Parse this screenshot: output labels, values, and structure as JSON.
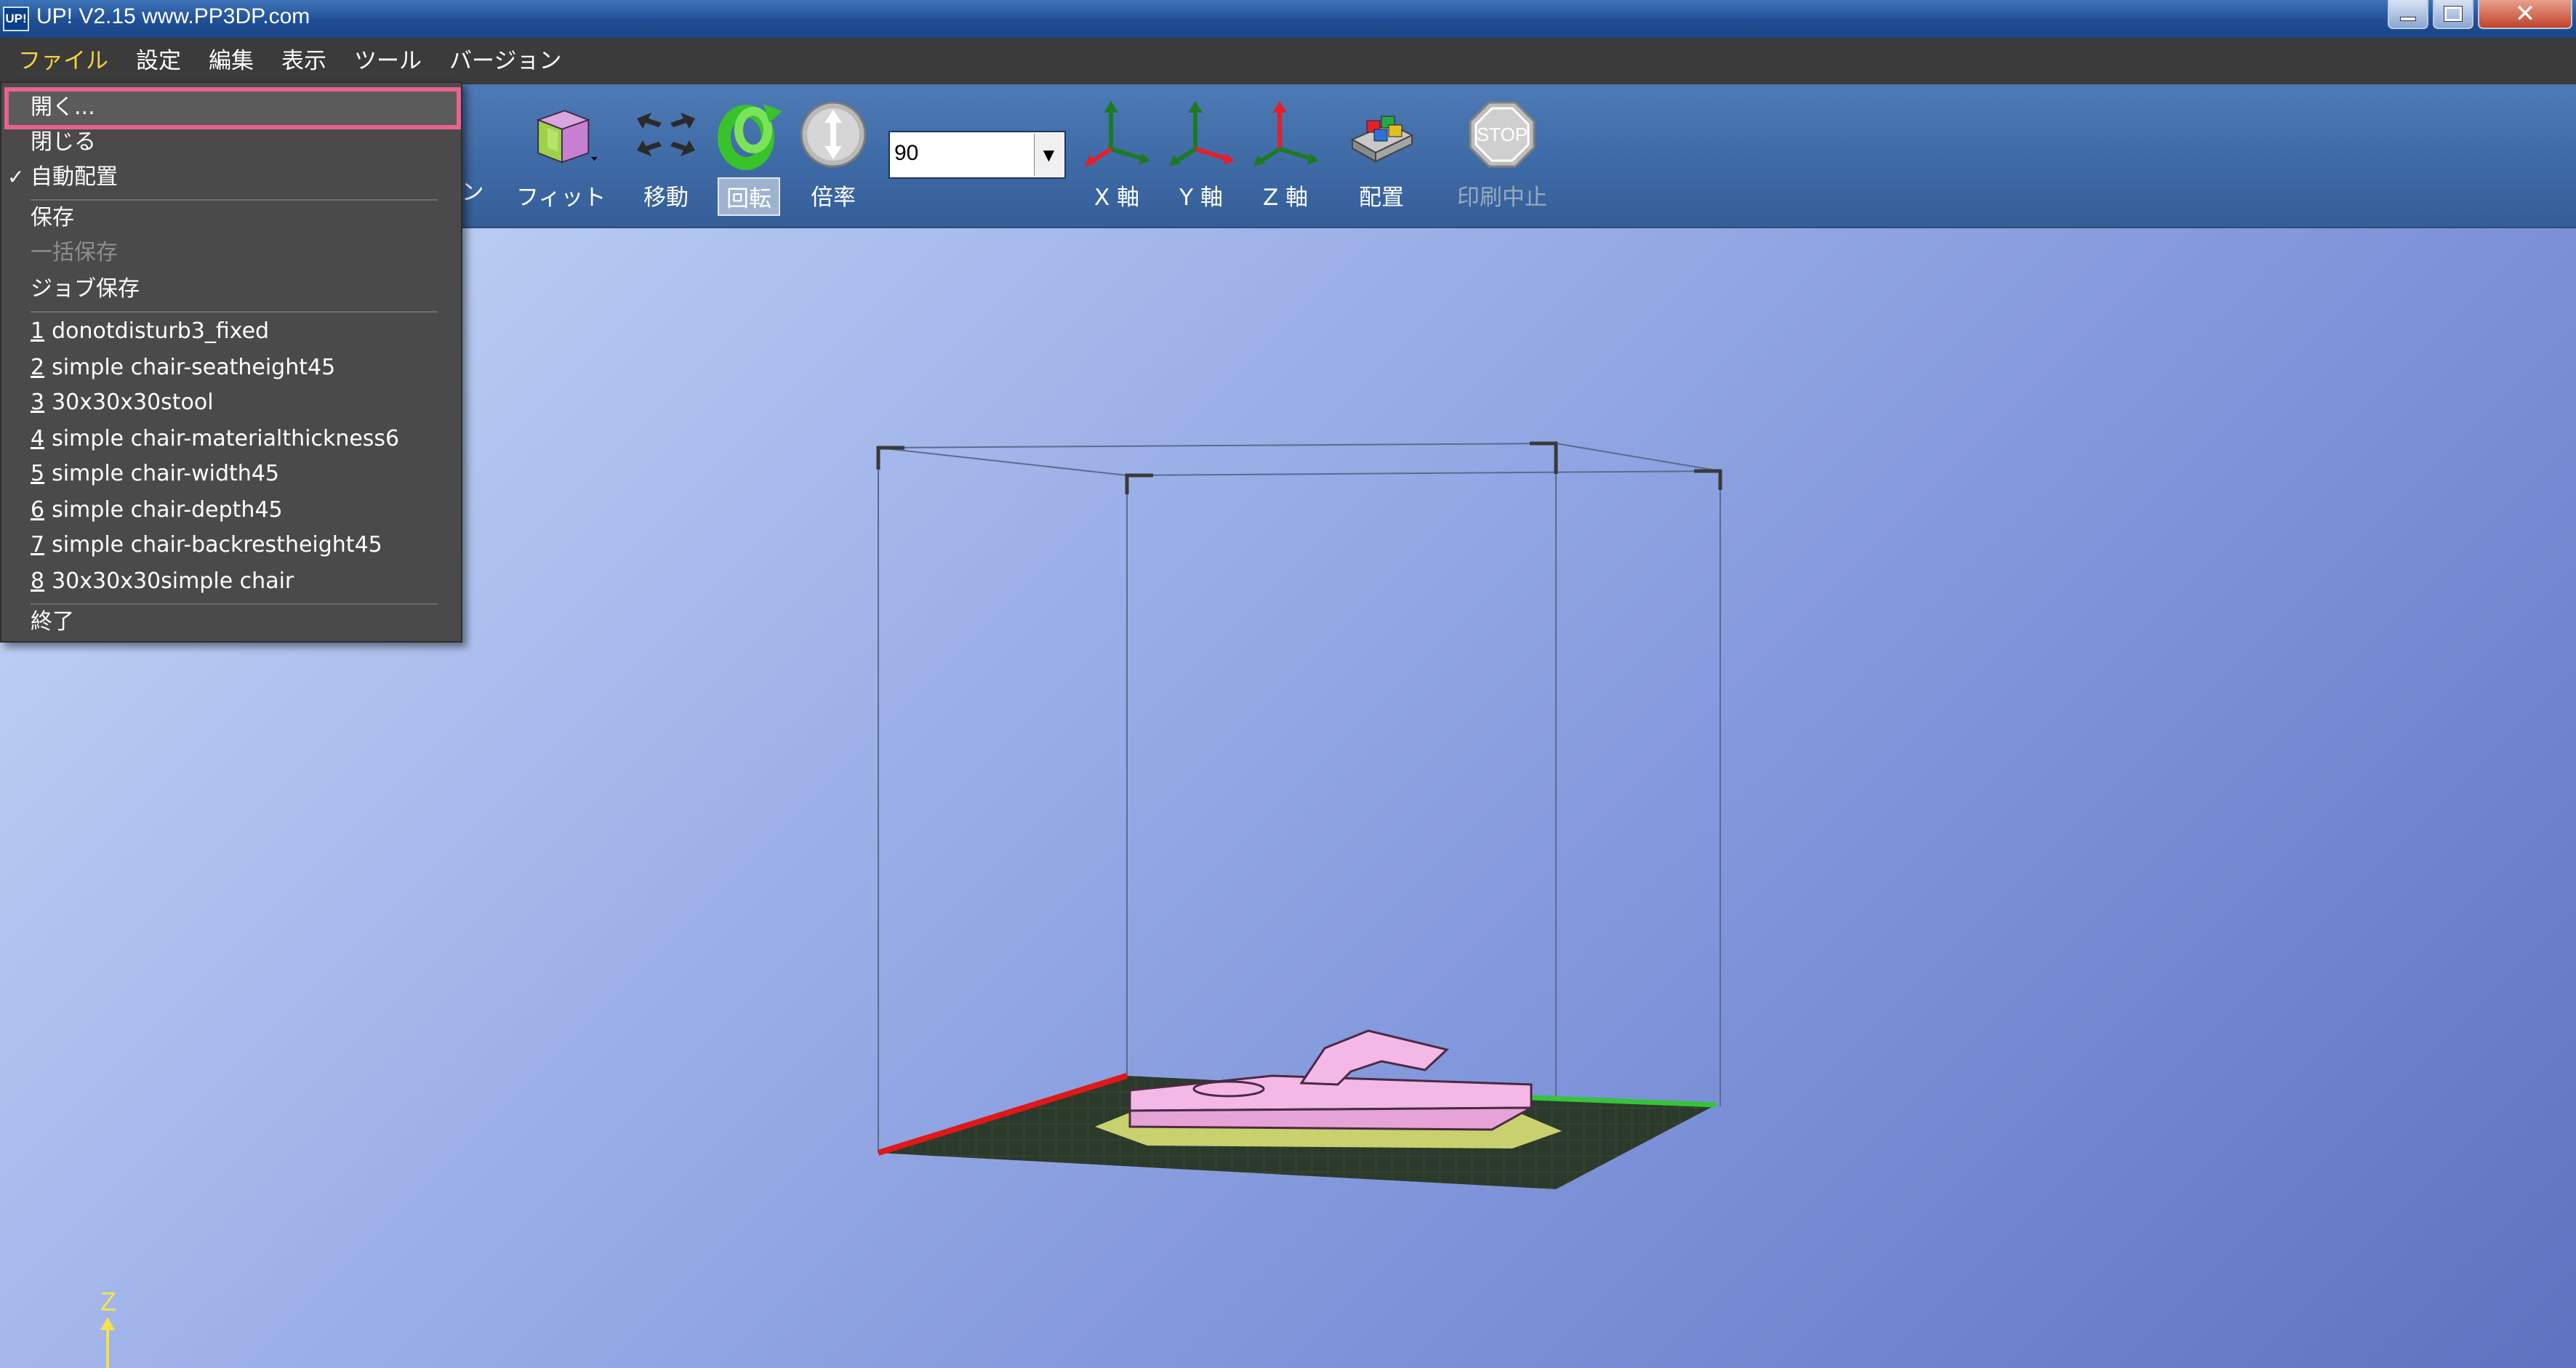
{
  "titlebar": {
    "app_icon_text": "UP!",
    "title": "UP!  V2.15 www.PP3DP.com"
  },
  "menubar": {
    "items": [
      "ファイル",
      "設定",
      "編集",
      "表示",
      "ツール",
      "バージョン"
    ]
  },
  "file_menu": {
    "open": "開く...",
    "close": "閉じる",
    "auto_place": "自動配置",
    "save": "保存",
    "save_all": "一括保存",
    "job_save": "ジョブ保存",
    "recent": [
      {
        "num": "1",
        "name": "donotdisturb3_fixed"
      },
      {
        "num": "2",
        "name": "simple chair-seatheight45"
      },
      {
        "num": "3",
        "name": "30x30x30stool"
      },
      {
        "num": "4",
        "name": "simple chair-materialthickness6"
      },
      {
        "num": "5",
        "name": "simple chair-width45"
      },
      {
        "num": "6",
        "name": "simple chair-depth45"
      },
      {
        "num": "7",
        "name": "simple chair-backrestheight45"
      },
      {
        "num": "8",
        "name": "30x30x30simple chair"
      }
    ],
    "exit": "終了"
  },
  "toolbar": {
    "partial_label": "ン",
    "fit": "フィット",
    "move": "移動",
    "rotate": "回転",
    "scale": "倍率",
    "combo_value": "90",
    "x_axis": "X 軸",
    "y_axis": "Y 軸",
    "z_axis": "Z 軸",
    "place": "配置",
    "stop_print": "印刷中止",
    "stop_icon_text": "STOP"
  },
  "viewport": {
    "z_label": "Z"
  },
  "colors": {
    "menubar_bg": "#3b3b3b",
    "highlight": "#e8638e",
    "model_pink": "#f4b8e6",
    "raft_yellow": "#e4ec7a"
  }
}
